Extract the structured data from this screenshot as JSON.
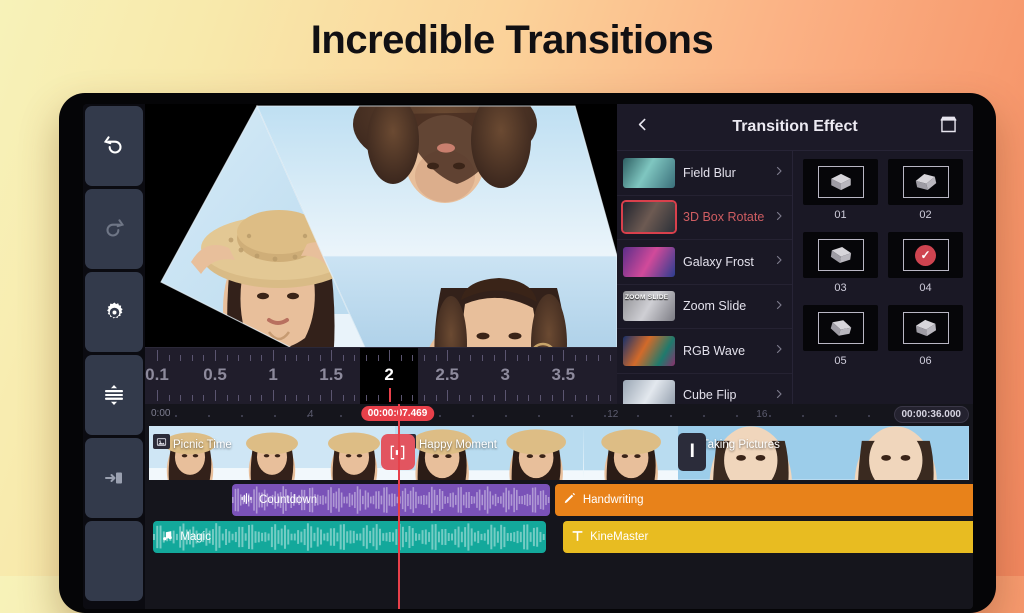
{
  "headline": "Incredible Transitions",
  "theme": {
    "bg_left": "#f7f2b9",
    "bg_right": "#f2875f",
    "accent_red": "#e8404a",
    "selected_red": "#cf4450"
  },
  "rail": {
    "items": [
      {
        "name": "undo",
        "icon": "undo-icon",
        "state": "enabled"
      },
      {
        "name": "redo",
        "icon": "redo-icon",
        "state": "disabled"
      },
      {
        "name": "settings",
        "icon": "gear-icon",
        "state": "enabled"
      },
      {
        "name": "track-expand",
        "icon": "expand-tracks-icon",
        "state": "enabled"
      },
      {
        "name": "export",
        "icon": "export-icon",
        "state": "enabled"
      }
    ]
  },
  "preview": {
    "ruler_numbers": [
      "0.1",
      "0.5",
      "1",
      "1.5",
      "2",
      "2.5",
      "3",
      "3.5"
    ],
    "active_number": "2"
  },
  "panel": {
    "title": "Transition Effect",
    "back_icon": "chevron-left-icon",
    "store_icon": "store-icon",
    "effects": [
      {
        "label": "Field Blur",
        "selected": false,
        "thumb_text": ""
      },
      {
        "label": "3D Box Rotate",
        "selected": true,
        "thumb_text": ""
      },
      {
        "label": "Galaxy Frost",
        "selected": false,
        "thumb_text": ""
      },
      {
        "label": "Zoom Slide",
        "selected": false,
        "thumb_text": "ZOOM SLIDE"
      },
      {
        "label": "RGB Wave",
        "selected": false,
        "thumb_text": ""
      },
      {
        "label": "Cube Flip",
        "selected": false,
        "thumb_text": ""
      }
    ],
    "variants": [
      {
        "num": "01",
        "selected": false
      },
      {
        "num": "02",
        "selected": false
      },
      {
        "num": "03",
        "selected": false
      },
      {
        "num": "04",
        "selected": true
      },
      {
        "num": "05",
        "selected": false
      },
      {
        "num": "06",
        "selected": false
      }
    ]
  },
  "timeline": {
    "start_label": "0:00",
    "marks": [
      "4",
      "12",
      "16"
    ],
    "playhead_time": "00:00:07.469",
    "total_time": "00:00:36.000",
    "clips": [
      {
        "label": "Picnic Time",
        "icon": "image-icon"
      },
      {
        "label": "Happy Moment",
        "icon": "image-icon"
      },
      {
        "label": "Taking Pictures",
        "icon": "image-icon"
      }
    ],
    "transition_marker_icon": "transition-box-icon",
    "insert_button_label": "I",
    "lanes": [
      {
        "label": "Countdown",
        "icon": "voice-icon",
        "color": "#7a52b8",
        "kind": "audio"
      },
      {
        "label": "Handwriting",
        "icon": "pen-icon",
        "color": "#e8821a",
        "kind": "effect"
      },
      {
        "label": "Magic",
        "icon": "music-icon",
        "color": "#13a89b",
        "kind": "audio"
      },
      {
        "label": "KineMaster",
        "icon": "text-icon",
        "color": "#e8bc21",
        "kind": "text"
      }
    ]
  }
}
